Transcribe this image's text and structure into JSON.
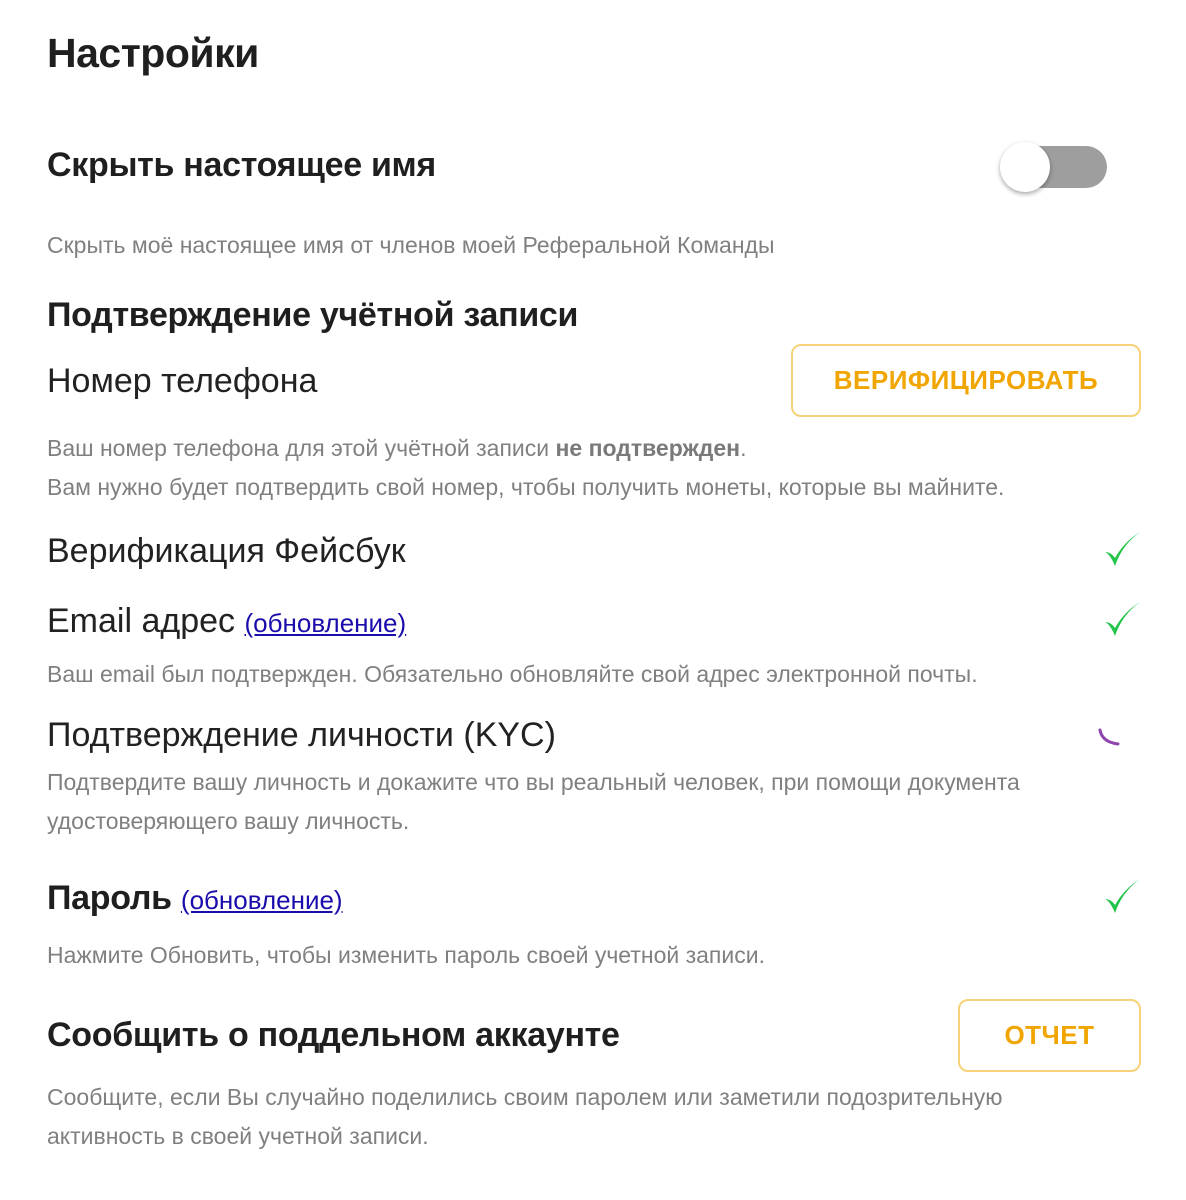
{
  "page": {
    "title": "Настройки"
  },
  "hide_name": {
    "title": "Скрыть настоящее имя",
    "description": "Скрыть моё настоящее имя от членов моей Реферальной Команды",
    "toggle_on": false
  },
  "verification": {
    "title": "Подтверждение учётной записи",
    "phone": {
      "label": "Номер телефона",
      "button_label": "ВЕРИФИЦИРОВАТЬ",
      "desc_before": "Ваш номер телефона для этой учётной записи ",
      "desc_bold": "не подтвержден",
      "desc_after": ".",
      "desc_line2": "Вам нужно будет подтвердить свой номер, чтобы получить монеты, которые вы майните."
    },
    "facebook": {
      "label": "Верификация Фейсбук",
      "status_icon": "check-icon"
    },
    "email": {
      "label": "Email адрес",
      "link": "(обновление)",
      "status_icon": "check-icon",
      "description": "Ваш email был подтвержден. Обязательно обновляйте свой адрес электронной почты."
    },
    "kyc": {
      "label": "Подтверждение личности (KYC)",
      "status_icon": "spinner-icon",
      "desc_line1": "Подтвердите вашу личность и докажите что вы реальный человек, при помощи документа",
      "desc_line2": "удостоверяющего вашу личность."
    }
  },
  "password": {
    "title": "Пароль",
    "link": "(обновление)",
    "status_icon": "check-icon",
    "description": "Нажмите Обновить, чтобы изменить пароль своей учетной записи."
  },
  "report": {
    "title": "Сообщить о поддельном аккаунте",
    "button_label": "ОТЧЕТ",
    "desc_line1": "Сообщите, если Вы случайно поделились своим паролем или заметили подозрительную",
    "desc_line2": "активность в своей учетной записи."
  },
  "colors": {
    "accent": "#f0a500",
    "button_border": "#f6d37a",
    "check": "#22c44a",
    "spinner": "#8e44ad",
    "link": "#1a0dab",
    "toggle_track": "#9e9e9e"
  }
}
